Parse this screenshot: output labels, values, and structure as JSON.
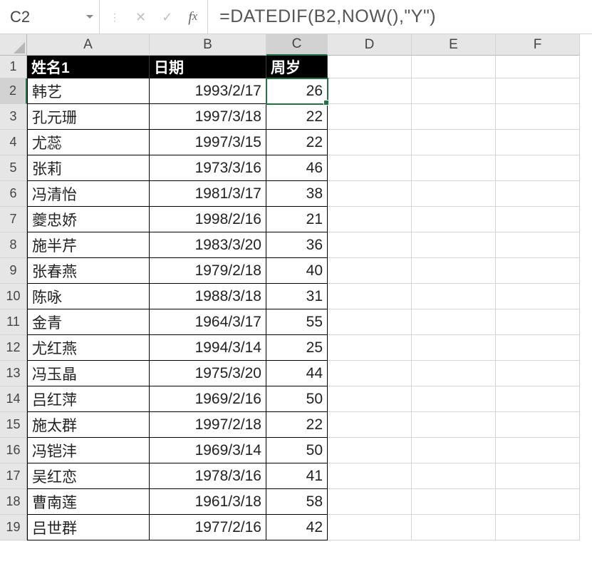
{
  "nameBox": "C2",
  "formula": "=DATEDIF(B2,NOW(),\"Y\")",
  "columns": [
    "A",
    "B",
    "C",
    "D",
    "E",
    "F"
  ],
  "activeCell": {
    "row": 2,
    "col": "C"
  },
  "tableHeaders": {
    "A": "姓名1",
    "B": "日期",
    "C": "周岁"
  },
  "rows": [
    {
      "n": 2,
      "A": "韩艺",
      "B": "1993/2/17",
      "C": "26"
    },
    {
      "n": 3,
      "A": "孔元珊",
      "B": "1997/3/18",
      "C": "22"
    },
    {
      "n": 4,
      "A": "尤蕊",
      "B": "1997/3/15",
      "C": "22"
    },
    {
      "n": 5,
      "A": "张莉",
      "B": "1973/3/16",
      "C": "46"
    },
    {
      "n": 6,
      "A": "冯清怡",
      "B": "1981/3/17",
      "C": "38"
    },
    {
      "n": 7,
      "A": "夔忠娇",
      "B": "1998/2/16",
      "C": "21"
    },
    {
      "n": 8,
      "A": "施半芹",
      "B": "1983/3/20",
      "C": "36"
    },
    {
      "n": 9,
      "A": "张春燕",
      "B": "1979/2/18",
      "C": "40"
    },
    {
      "n": 10,
      "A": "陈咏",
      "B": "1988/3/18",
      "C": "31"
    },
    {
      "n": 11,
      "A": "金青",
      "B": "1964/3/17",
      "C": "55"
    },
    {
      "n": 12,
      "A": "尤红燕",
      "B": "1994/3/14",
      "C": "25"
    },
    {
      "n": 13,
      "A": "冯玉晶",
      "B": "1975/3/20",
      "C": "44"
    },
    {
      "n": 14,
      "A": "吕红萍",
      "B": "1969/2/16",
      "C": "50"
    },
    {
      "n": 15,
      "A": "施太群",
      "B": "1997/2/18",
      "C": "22"
    },
    {
      "n": 16,
      "A": "冯铠沣",
      "B": "1969/3/14",
      "C": "50"
    },
    {
      "n": 17,
      "A": "吴红恋",
      "B": "1978/3/16",
      "C": "41"
    },
    {
      "n": 18,
      "A": "曹南莲",
      "B": "1961/3/18",
      "C": "58"
    },
    {
      "n": 19,
      "A": "吕世群",
      "B": "1977/2/16",
      "C": "42"
    }
  ]
}
